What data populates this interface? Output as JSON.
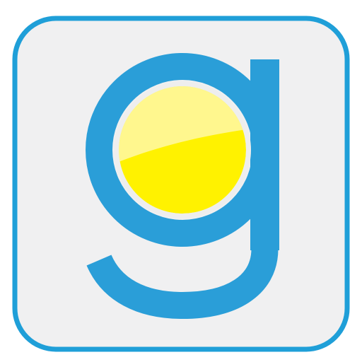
{
  "icon": {
    "name": "g-letter-sun-app-icon",
    "colors": {
      "background": "#ffffff",
      "tile_fill": "#f0f0f1",
      "tile_border": "#1f9fd8",
      "letter": "#2a9ed8",
      "sun_ring": "#eeeeee",
      "sun_yellow": "#fff200",
      "sun_highlight": "#fff78e"
    }
  }
}
